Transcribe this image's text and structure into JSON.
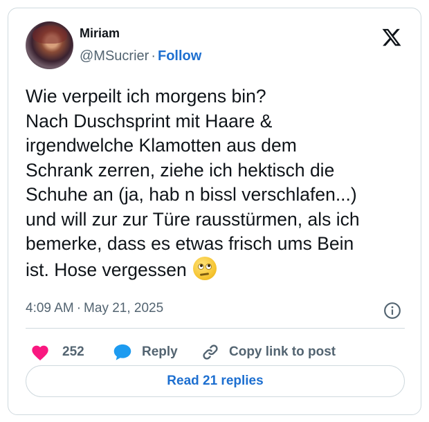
{
  "author": {
    "name": "Miriam",
    "handle": "@MSucrier",
    "separator": "·",
    "follow_label": "Follow"
  },
  "tweet": {
    "text": "Wie verpeilt ich morgens bin?\nNach Duschsprint mit Haare &\nirgendwelche Klamotten aus dem\nSchrank zerren, ziehe ich hektisch die\nSchuhe an (ja, hab n bissl verschlafen...)\nund will zur zur Türe rausstürmen, als ich\nbemerke, dass es etwas frisch ums Bein\nist. Hose vergessen",
    "emoji": "face-with-rolling-eyes"
  },
  "meta": {
    "time": "4:09 AM",
    "separator": "·",
    "date": "May 21, 2025"
  },
  "actions": {
    "likes": "252",
    "reply_label": "Reply",
    "copy_label": "Copy link to post"
  },
  "footer": {
    "read_replies_label": "Read 21 replies"
  },
  "icons": {
    "logo": "x-logo-icon",
    "info": "info-icon",
    "like": "heart-icon",
    "reply": "speech-bubble-icon",
    "copy": "link-icon"
  },
  "colors": {
    "accent": "#1d6fd0",
    "heart": "#f91880",
    "text": "#0f1419",
    "muted": "#536471",
    "border": "#cfd9de"
  }
}
